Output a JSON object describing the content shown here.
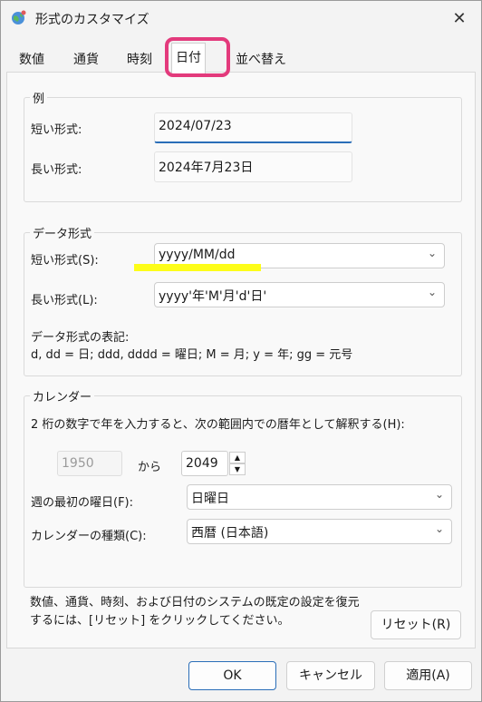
{
  "window": {
    "title": "形式のカスタマイズ"
  },
  "tabs": [
    {
      "label": "数値"
    },
    {
      "label": "通貨"
    },
    {
      "label": "時刻"
    },
    {
      "label": "日付"
    },
    {
      "label": "並べ替え"
    }
  ],
  "example": {
    "group_title": "例",
    "short_label": "短い形式:",
    "short_value": "2024/07/23",
    "long_label": "長い形式:",
    "long_value": "2024年7月23日"
  },
  "data_format": {
    "group_title": "データ形式",
    "short_label": "短い形式(S):",
    "short_value": "yyyy/MM/dd",
    "long_label": "長い形式(L):",
    "long_value": "yyyy'年'M'月'd'日'",
    "notation_title": "データ形式の表記:",
    "notation_text": "d, dd = 日;  ddd, dddd = 曜日; M = 月; y = 年; gg = 元号"
  },
  "calendar": {
    "group_title": "カレンダー",
    "two_digit_text": "2 桁の数字で年を入力すると、次の範囲内での暦年として解釈する(H):",
    "from_year": "1950",
    "from_label": "から",
    "to_year": "2049",
    "first_day_label": "週の最初の曜日(F):",
    "first_day_value": "日曜日",
    "calendar_type_label": "カレンダーの種類(C):",
    "calendar_type_value": "西暦 (日本語)"
  },
  "reset": {
    "info_line1": "数値、通貨、時刻、および日付のシステムの既定の設定を復元",
    "info_line2": "するには、[リセット] をクリックしてください。",
    "button": "リセット(R)"
  },
  "footer": {
    "ok": "OK",
    "cancel": "キャンセル",
    "apply": "適用(A)"
  },
  "colors": {
    "tab_highlight": "#e33a7c",
    "text_highlight": "#fdfd19",
    "accent": "#2a6eb8"
  }
}
